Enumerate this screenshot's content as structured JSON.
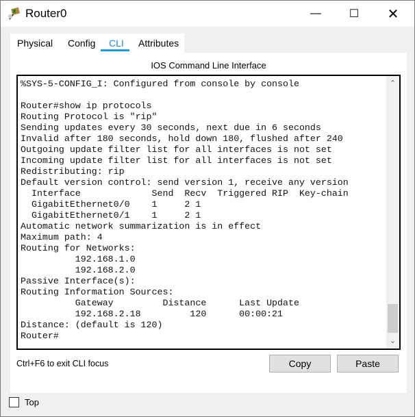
{
  "window": {
    "title": "Router0",
    "icon": "router-icon"
  },
  "tabs": [
    {
      "label": "Physical"
    },
    {
      "label": "Config"
    },
    {
      "label": "CLI",
      "active": true
    },
    {
      "label": "Attributes"
    }
  ],
  "cli": {
    "header": "IOS Command Line Interface",
    "lines": [
      "Router#",
      "%SYS-5-CONFIG_I: Configured from console by console",
      "",
      "Router#show ip protocols",
      "Routing Protocol is \"rip\"",
      "Sending updates every 30 seconds, next due in 6 seconds",
      "Invalid after 180 seconds, hold down 180, flushed after 240",
      "Outgoing update filter list for all interfaces is not set",
      "Incoming update filter list for all interfaces is not set",
      "Redistributing: rip",
      "Default version control: send version 1, receive any version",
      "  Interface             Send  Recv  Triggered RIP  Key-chain",
      "  GigabitEthernet0/0    1     2 1",
      "  GigabitEthernet0/1    1     2 1",
      "Automatic network summarization is in effect",
      "Maximum path: 4",
      "Routing for Networks:",
      "          192.168.1.0",
      "          192.168.2.0",
      "Passive Interface(s):",
      "Routing Information Sources:",
      "          Gateway         Distance      Last Update",
      "          192.168.2.18         120      00:00:21",
      "Distance: (default is 120)",
      "Router#"
    ],
    "hint": "Ctrl+F6 to exit CLI focus",
    "copy_label": "Copy",
    "paste_label": "Paste"
  },
  "footer": {
    "top_label": "Top",
    "top_checked": false
  },
  "colors": {
    "accent": "#1e9bd7"
  }
}
